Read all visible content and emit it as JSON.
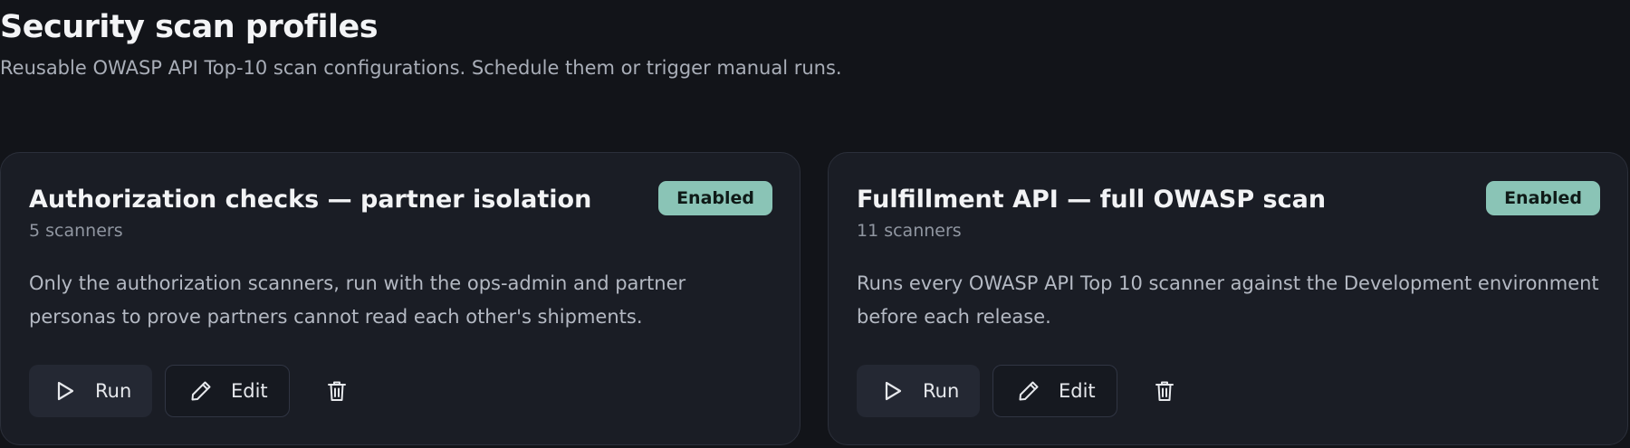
{
  "header": {
    "title": "Security scan profiles",
    "subtitle": "Reusable OWASP API Top-10 scan configurations. Schedule them or trigger manual runs."
  },
  "colors": {
    "background": "#121419",
    "card": "#1a1d25",
    "badge": "#8ac4b6"
  },
  "profiles": [
    {
      "title": "Authorization checks — partner isolation",
      "meta": "5 scanners",
      "status": "Enabled",
      "description": "Only the authorization scanners, run with the ops-admin and partner personas to prove partners cannot read each other's shipments.",
      "run_label": "Run",
      "edit_label": "Edit",
      "icons": {
        "run": "play-icon",
        "edit": "pencil-icon",
        "delete": "trash-icon"
      }
    },
    {
      "title": "Fulfillment API — full OWASP scan",
      "meta": "11 scanners",
      "status": "Enabled",
      "description": "Runs every OWASP API Top 10 scanner against the Development environment before each release.",
      "run_label": "Run",
      "edit_label": "Edit",
      "icons": {
        "run": "play-icon",
        "edit": "pencil-icon",
        "delete": "trash-icon"
      }
    }
  ]
}
